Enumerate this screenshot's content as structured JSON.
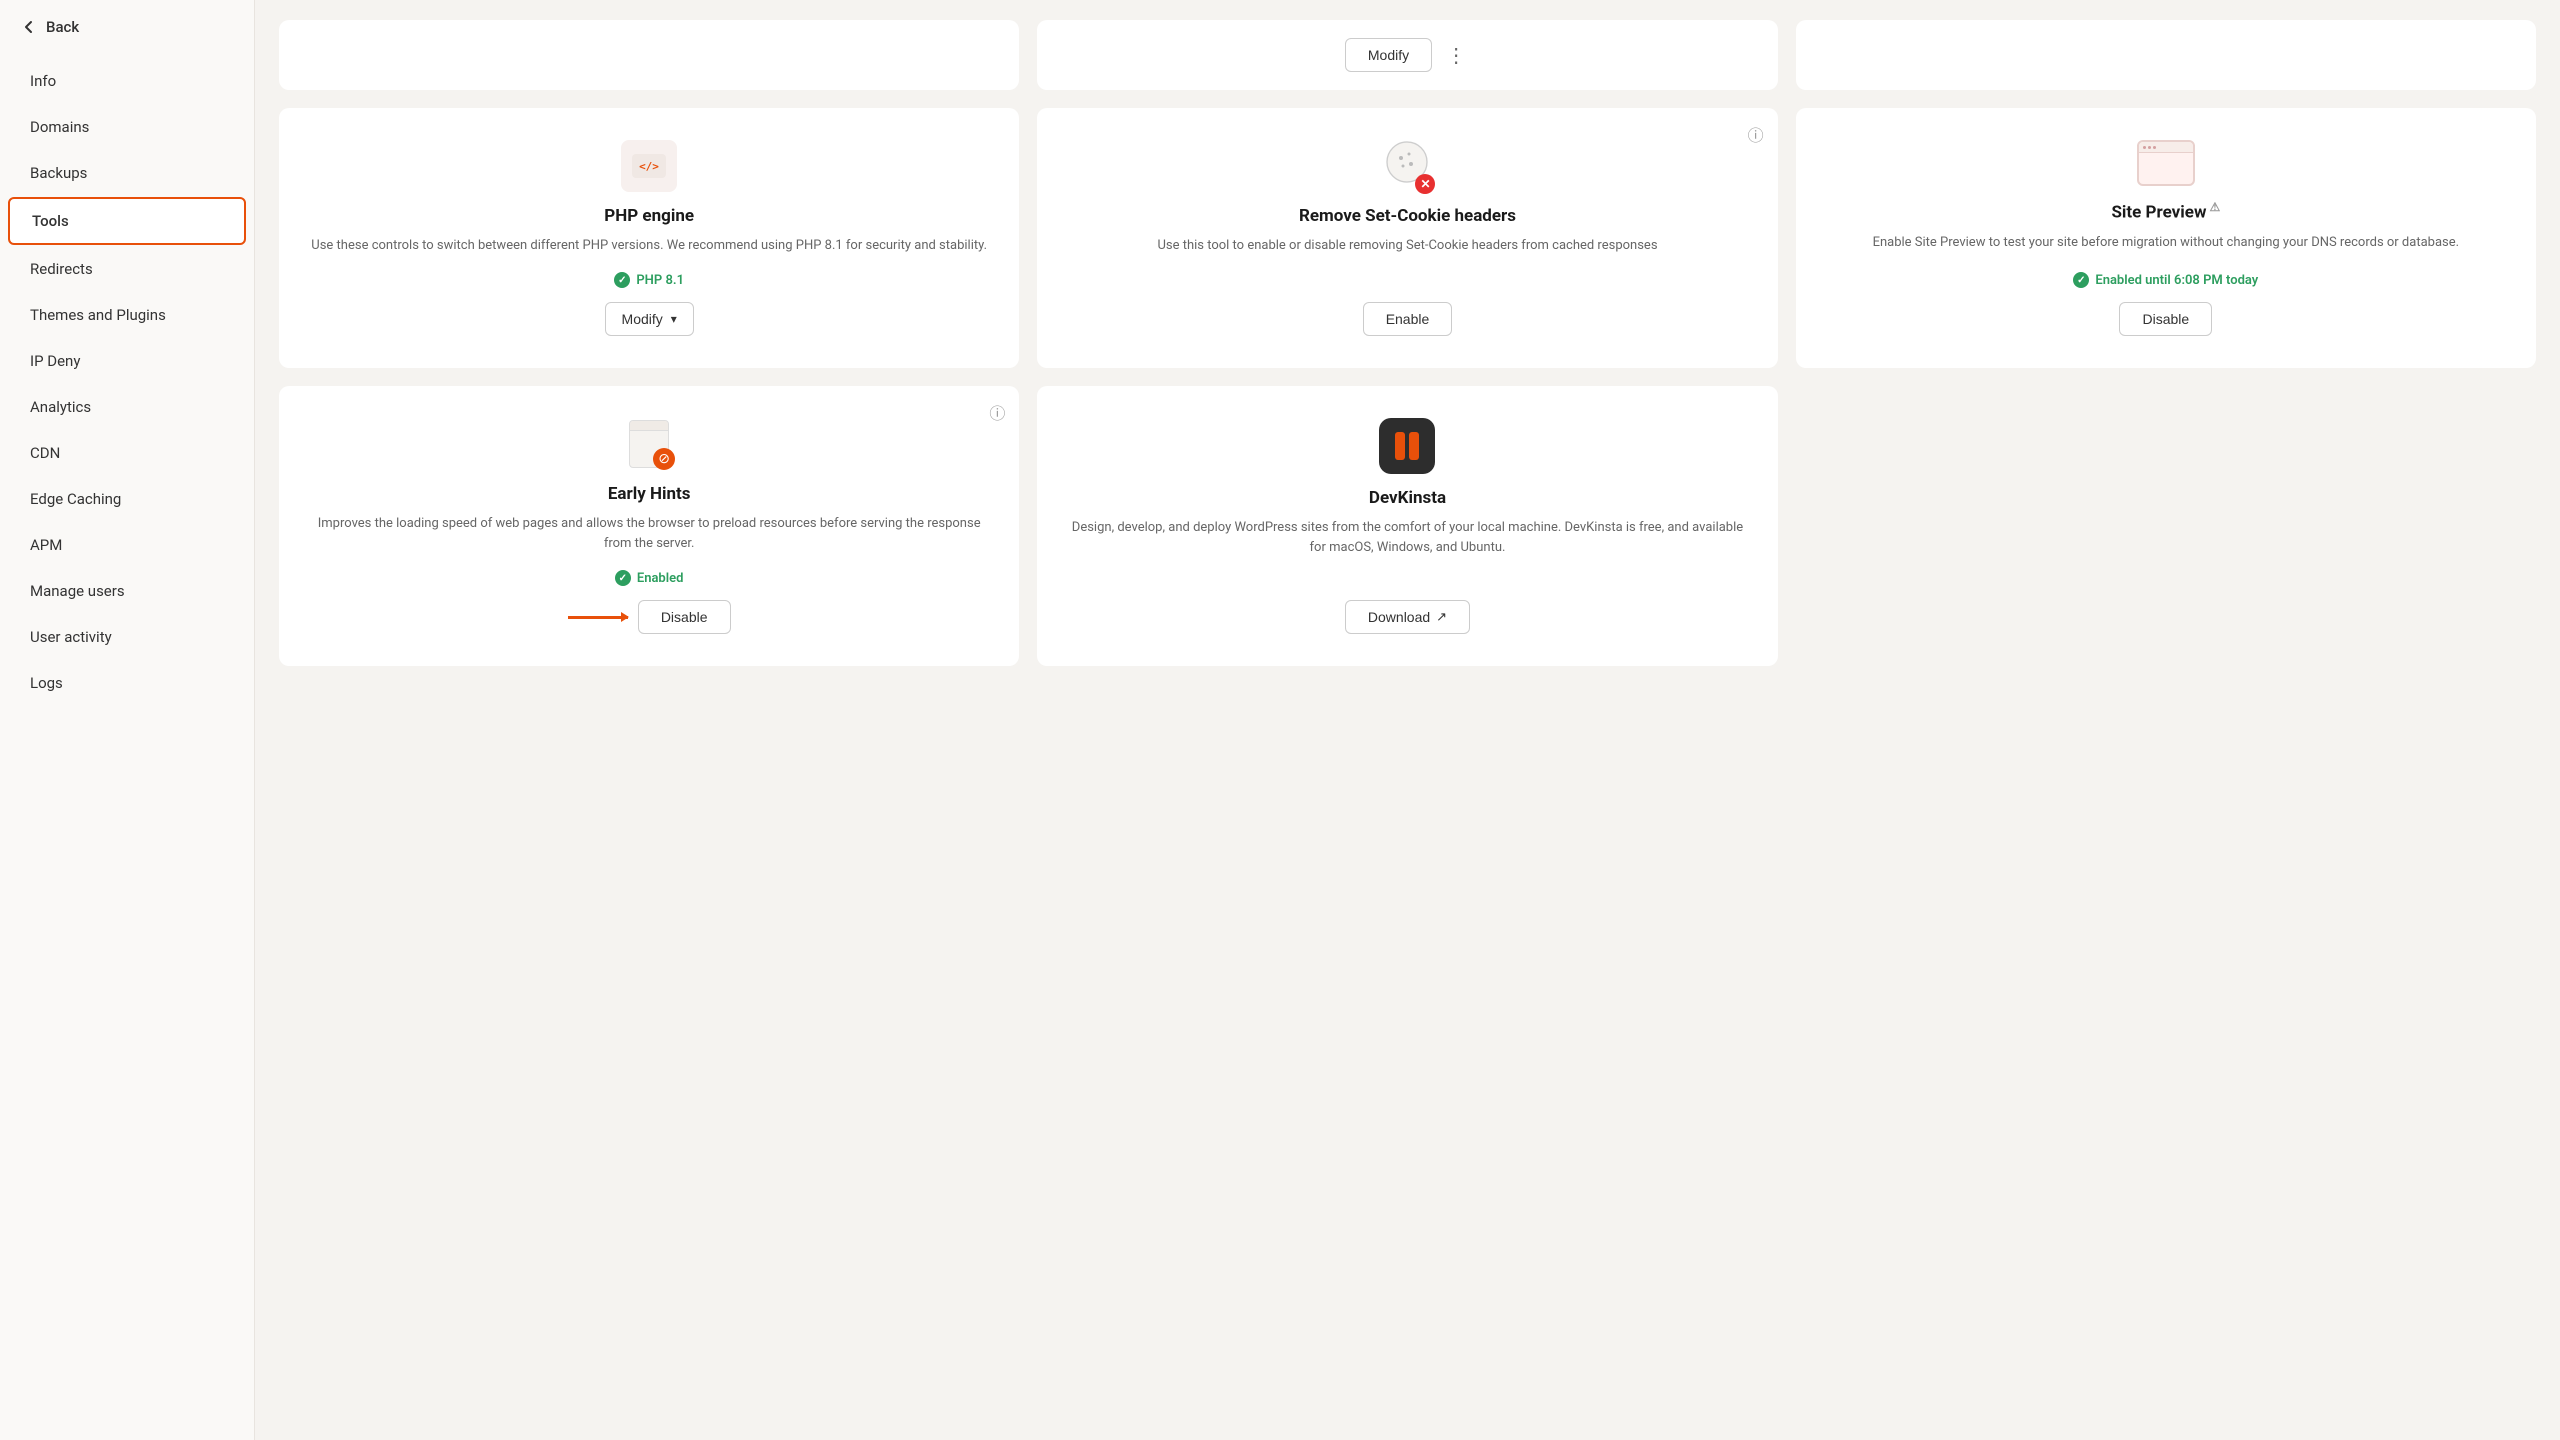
{
  "sidebar": {
    "back_label": "Back",
    "items": [
      {
        "id": "info",
        "label": "Info",
        "active": false
      },
      {
        "id": "domains",
        "label": "Domains",
        "active": false
      },
      {
        "id": "backups",
        "label": "Backups",
        "active": false
      },
      {
        "id": "tools",
        "label": "Tools",
        "active": true
      },
      {
        "id": "redirects",
        "label": "Redirects",
        "active": false
      },
      {
        "id": "themes-plugins",
        "label": "Themes and Plugins",
        "active": false
      },
      {
        "id": "ip-deny",
        "label": "IP Deny",
        "active": false
      },
      {
        "id": "analytics",
        "label": "Analytics",
        "active": false
      },
      {
        "id": "cdn",
        "label": "CDN",
        "active": false
      },
      {
        "id": "edge-caching",
        "label": "Edge Caching",
        "active": false
      },
      {
        "id": "apm",
        "label": "APM",
        "active": false
      },
      {
        "id": "manage-users",
        "label": "Manage users",
        "active": false
      },
      {
        "id": "user-activity",
        "label": "User activity",
        "active": false
      },
      {
        "id": "logs",
        "label": "Logs",
        "active": false
      }
    ]
  },
  "top_row": {
    "card1": {
      "button_label": "Modify",
      "more_icon": "⋮"
    },
    "card2": {},
    "card3": {}
  },
  "cards": [
    {
      "id": "php-engine",
      "title": "PHP engine",
      "desc": "Use these controls to switch between different PHP versions. We recommend using PHP 8.1 for security and stability.",
      "status_text": "PHP 8.1",
      "status_type": "green",
      "button_label": "Modify",
      "button_type": "modify-dropdown",
      "has_info": false
    },
    {
      "id": "remove-set-cookie",
      "title": "Remove Set-Cookie headers",
      "desc": "Use this tool to enable or disable removing Set-Cookie headers from cached responses",
      "status_text": "",
      "status_type": "none",
      "button_label": "Enable",
      "button_type": "simple",
      "has_info": true
    },
    {
      "id": "site-preview",
      "title": "Site Preview",
      "desc": "Enable Site Preview to test your site before migration without changing your DNS records or database.",
      "status_text": "Enabled until 6:08 PM today",
      "status_type": "green",
      "button_label": "Disable",
      "button_type": "simple",
      "has_info": false,
      "has_warning": true
    },
    {
      "id": "early-hints",
      "title": "Early Hints",
      "desc": "Improves the loading speed of web pages and allows the browser to preload resources before serving the response from the server.",
      "status_text": "Enabled",
      "status_type": "green",
      "button_label": "Disable",
      "button_type": "simple-with-arrow",
      "has_info": true
    },
    {
      "id": "devkinsta",
      "title": "DevKinsta",
      "desc": "Design, develop, and deploy WordPress sites from the comfort of your local machine. DevKinsta is free, and available for macOS, Windows, and Ubuntu.",
      "status_text": "",
      "status_type": "none",
      "button_label": "Download",
      "button_type": "external",
      "has_info": false
    }
  ],
  "icons": {
    "back_arrow": "←",
    "chevron_down": "▾",
    "external_link": "↗",
    "info_circle": "ⓘ",
    "more_dots": "⋮",
    "checkmark": "✓",
    "warning": "⚠"
  }
}
